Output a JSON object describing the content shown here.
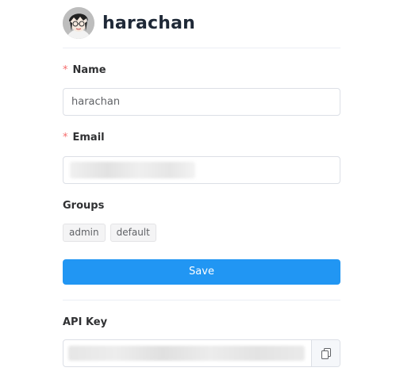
{
  "profile": {
    "username": "harachan",
    "avatar_icon": "user-avatar-icon"
  },
  "form": {
    "name_label": "Name",
    "name_value": "harachan",
    "email_label": "Email",
    "email_value": "",
    "required_mark": "*",
    "groups_label": "Groups",
    "groups": [
      "admin",
      "default"
    ],
    "save_label": "Save"
  },
  "api": {
    "label": "API Key",
    "value": "",
    "copy_icon": "copy-icon"
  },
  "colors": {
    "accent": "#2196f3",
    "required": "#f56c6c",
    "border": "#dcdfe6"
  }
}
